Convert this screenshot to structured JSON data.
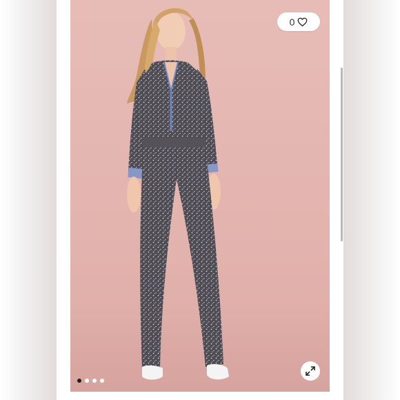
{
  "listing": {
    "like_count": "0",
    "icons": {
      "like": "heart-outline-icon",
      "expand": "expand-arrows-icon"
    },
    "carousel": {
      "total": 4,
      "active_index": 0
    }
  },
  "colors": {
    "backdrop": "#e5b7b2",
    "jumpsuit": "#4e4b52",
    "dot_active": "#1e1e1e",
    "dot_inactive": "#ffffff"
  }
}
